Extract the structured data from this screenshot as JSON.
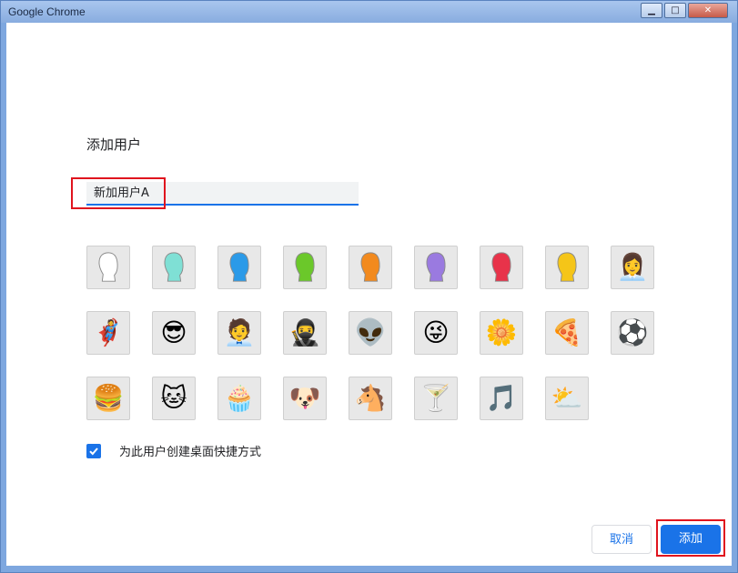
{
  "window": {
    "title": "Google Chrome",
    "controls": {
      "minimize": "▁",
      "maximize": "□",
      "close": "✕"
    }
  },
  "dialog": {
    "heading": "添加用户",
    "name_input": {
      "value": "新加用户A"
    },
    "avatars": [
      {
        "name": "avatar-generic-white",
        "kind": "silhouette",
        "color": "#ffffff"
      },
      {
        "name": "avatar-generic-aqua",
        "kind": "silhouette",
        "color": "#7fe0d5"
      },
      {
        "name": "avatar-generic-blue",
        "kind": "silhouette",
        "color": "#2b9ae8"
      },
      {
        "name": "avatar-generic-green",
        "kind": "silhouette",
        "color": "#6bc82a"
      },
      {
        "name": "avatar-generic-orange",
        "kind": "silhouette",
        "color": "#f28a1e"
      },
      {
        "name": "avatar-generic-purple",
        "kind": "silhouette",
        "color": "#9a7ae0"
      },
      {
        "name": "avatar-generic-red",
        "kind": "silhouette",
        "color": "#e8334a"
      },
      {
        "name": "avatar-generic-yellow",
        "kind": "silhouette",
        "color": "#f5c518"
      },
      {
        "name": "avatar-businesswoman",
        "kind": "emoji",
        "glyph": "👩‍💼"
      },
      {
        "name": "avatar-superhero",
        "kind": "emoji",
        "glyph": "🦸"
      },
      {
        "name": "avatar-woman-sunglasses",
        "kind": "emoji",
        "glyph": "😎"
      },
      {
        "name": "avatar-businessman",
        "kind": "emoji",
        "glyph": "🧑‍💼"
      },
      {
        "name": "avatar-ninja",
        "kind": "emoji",
        "glyph": "🥷"
      },
      {
        "name": "avatar-alien",
        "kind": "emoji",
        "glyph": "👽"
      },
      {
        "name": "avatar-awesome-face",
        "kind": "emoji",
        "glyph": "😜"
      },
      {
        "name": "avatar-flower",
        "kind": "emoji",
        "glyph": "🌼"
      },
      {
        "name": "avatar-pizza",
        "kind": "emoji",
        "glyph": "🍕"
      },
      {
        "name": "avatar-soccer-ball",
        "kind": "emoji",
        "glyph": "⚽"
      },
      {
        "name": "avatar-burger",
        "kind": "emoji",
        "glyph": "🍔"
      },
      {
        "name": "avatar-cat",
        "kind": "emoji",
        "glyph": "🐱"
      },
      {
        "name": "avatar-cupcake",
        "kind": "emoji",
        "glyph": "🧁"
      },
      {
        "name": "avatar-dog",
        "kind": "emoji",
        "glyph": "🐶"
      },
      {
        "name": "avatar-horse",
        "kind": "emoji",
        "glyph": "🐴"
      },
      {
        "name": "avatar-margarita",
        "kind": "emoji",
        "glyph": "🍸"
      },
      {
        "name": "avatar-music-note",
        "kind": "emoji",
        "glyph": "🎵"
      },
      {
        "name": "avatar-sun-and-cloud",
        "kind": "emoji",
        "glyph": "⛅"
      }
    ],
    "shortcut_checkbox": {
      "checked": true,
      "label": "为此用户创建桌面快捷方式"
    },
    "buttons": {
      "cancel": "取消",
      "add": "添加"
    }
  },
  "colors": {
    "accent": "#1a73e8",
    "highlight": "#e0141e"
  }
}
